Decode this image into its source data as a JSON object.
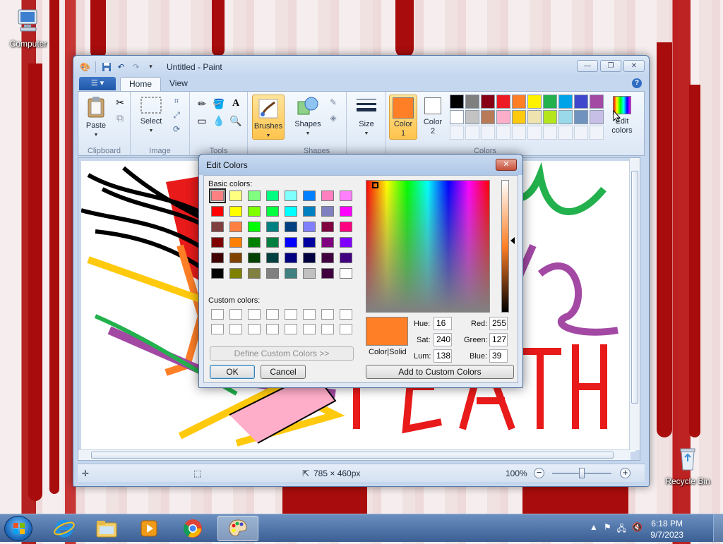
{
  "desktop": {
    "icons": [
      {
        "label": "Computer"
      },
      {
        "label": "Recycle Bin"
      }
    ]
  },
  "paint": {
    "title": "Untitled - Paint",
    "tabs": [
      "Home",
      "View"
    ],
    "ribbon": {
      "paste": "Paste",
      "select": "Select",
      "brushes": "Brushes",
      "shapes": "Shapes",
      "size": "Size",
      "color1_l1": "Color",
      "color1_l2": "1",
      "color2_l1": "Color",
      "color2_l2": "2",
      "edit_colors_l1": "Edit",
      "edit_colors_l2": "colors",
      "groups": [
        "Clipboard",
        "Image",
        "Tools",
        "Shapes",
        "Colors"
      ],
      "color1_value": "#ff7f27",
      "color2_value": "#ffffff",
      "palette_row1": [
        "#000000",
        "#7f7f7f",
        "#880015",
        "#ed1c24",
        "#ff7f27",
        "#fff200",
        "#22b14c",
        "#00a2e8",
        "#3f48cc",
        "#a349a4"
      ],
      "palette_row2": [
        "#ffffff",
        "#c3c3c3",
        "#b97a57",
        "#ffaec9",
        "#ffc90e",
        "#efe4b0",
        "#b5e61d",
        "#99d9ea",
        "#7092be",
        "#c8bfe7"
      ]
    },
    "status": {
      "image_size": "785 × 460px",
      "zoom": "100%"
    }
  },
  "dialog": {
    "title": "Edit Colors",
    "basic_label": "Basic colors:",
    "custom_label": "Custom colors:",
    "define_btn": "Define Custom Colors >>",
    "ok": "OK",
    "cancel": "Cancel",
    "add_btn": "Add to Custom Colors",
    "preview_label": "Color|Solid",
    "preview_color": "#ff7f27",
    "hue_label": "Hue:",
    "hue": "16",
    "sat_label": "Sat:",
    "sat": "240",
    "lum_label": "Lum:",
    "lum": "138",
    "red_label": "Red:",
    "red": "255",
    "green_label": "Green:",
    "green": "127",
    "blue_label": "Blue:",
    "blue": "39",
    "basic_colors": [
      [
        "#ff8080",
        "#ffff80",
        "#80ff80",
        "#00ff80",
        "#80ffff",
        "#0080ff",
        "#ff80c0",
        "#ff80ff"
      ],
      [
        "#ff0000",
        "#ffff00",
        "#80ff00",
        "#00ff40",
        "#00ffff",
        "#0080c0",
        "#8080c0",
        "#ff00ff"
      ],
      [
        "#804040",
        "#ff8040",
        "#00ff00",
        "#008080",
        "#004080",
        "#8080ff",
        "#800040",
        "#ff0080"
      ],
      [
        "#800000",
        "#ff8000",
        "#008000",
        "#008040",
        "#0000ff",
        "#0000a0",
        "#800080",
        "#8000ff"
      ],
      [
        "#400000",
        "#804000",
        "#004000",
        "#004040",
        "#000080",
        "#000040",
        "#400040",
        "#400080"
      ],
      [
        "#000000",
        "#808000",
        "#808040",
        "#808080",
        "#408080",
        "#c0c0c0",
        "#400040",
        "#ffffff"
      ]
    ]
  },
  "taskbar": {
    "time": "6:18 PM",
    "date": "9/7/2023"
  }
}
